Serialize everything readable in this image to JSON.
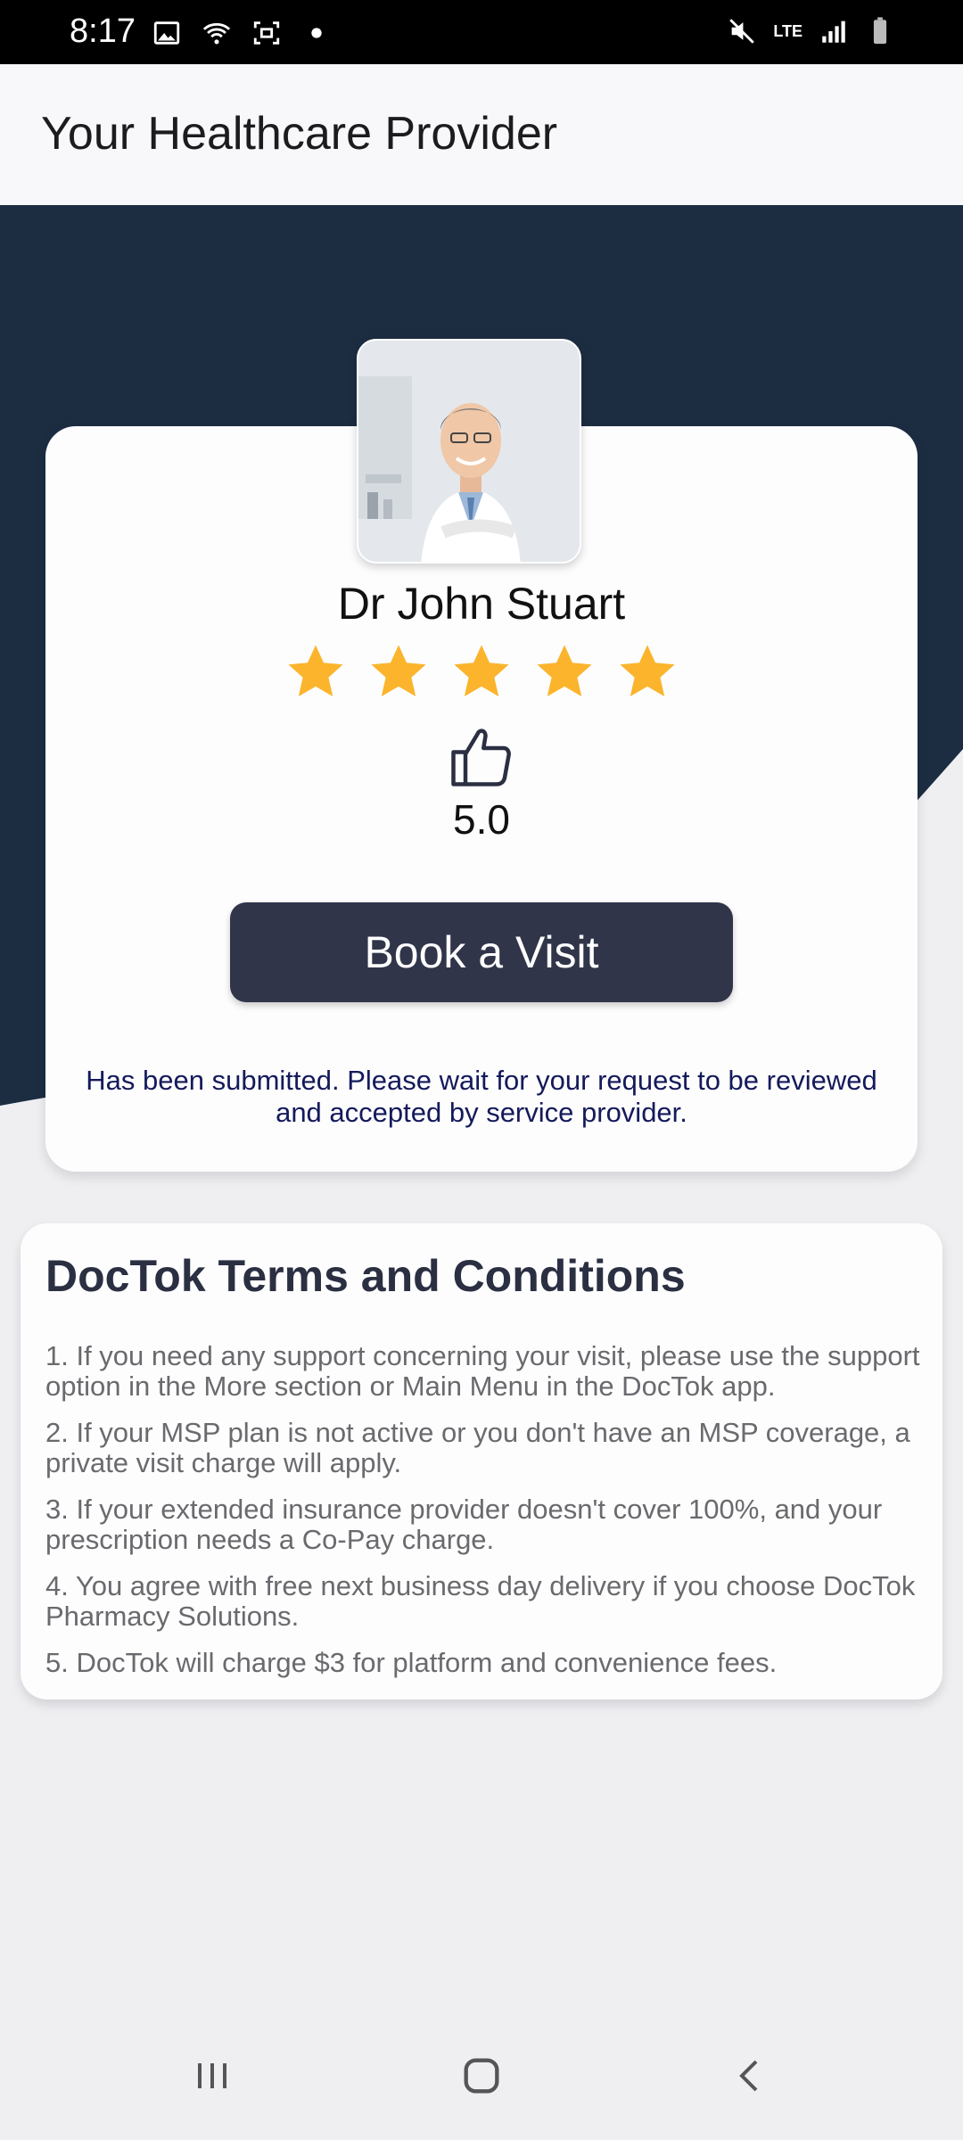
{
  "status_bar": {
    "time": "8:17",
    "network": "LTE"
  },
  "header": {
    "title": "Your Healthcare Provider"
  },
  "provider": {
    "name": "Dr John Stuart",
    "stars": 5,
    "rating": "5.0",
    "book_label": "Book a Visit",
    "message": "Has been submitted. Please wait for your request to be reviewed and accepted by service provider."
  },
  "terms": {
    "title": "DocTok Terms and Conditions",
    "items": [
      "1. If you need any support concerning your visit, please use the support option in the More section or Main Menu in the DocTok app.",
      "2. If your MSP plan is not active or you don't have an MSP coverage, a private visit charge will apply.",
      "3. If your extended insurance provider doesn't cover 100%, and your prescription needs a Co-Pay charge.",
      "4. You agree with free next business day delivery if you choose DocTok Pharmacy Solutions.",
      "5. DocTok will charge $3 for platform and convenience fees."
    ]
  },
  "colors": {
    "hero_dark": "#1c2d42",
    "button_bg": "#30354a",
    "star": "#fbb42c",
    "message_text": "#141a5a"
  },
  "icons": {
    "thumb": "thumbs-up-icon",
    "star": "star-icon",
    "nav_recent": "recent-apps-icon",
    "nav_home": "home-icon",
    "nav_back": "back-icon"
  }
}
